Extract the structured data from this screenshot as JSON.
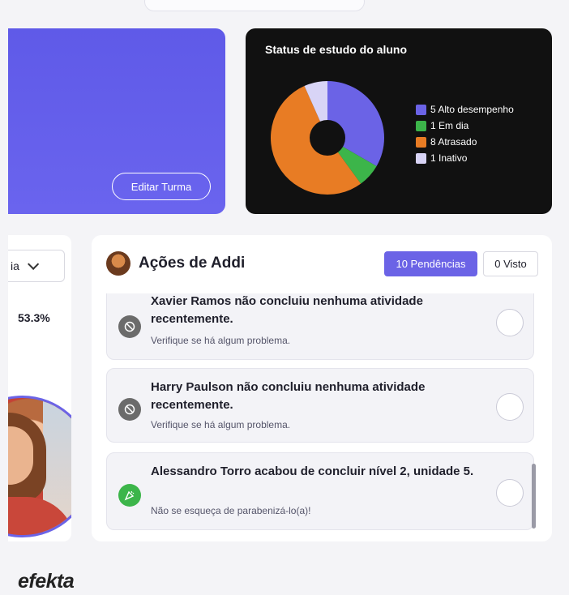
{
  "class_card": {
    "edit_button_label": "Editar Turma"
  },
  "status_card": {
    "title": "Status de estudo do aluno",
    "legend": [
      {
        "label": "5 Alto desempenho",
        "color": "#6b63e6"
      },
      {
        "label": "1 Em dia",
        "color": "#3cb54a"
      },
      {
        "label": "8 Atrasado",
        "color": "#e87c24"
      },
      {
        "label": "1 Inativo",
        "color": "#d8d4f6"
      }
    ]
  },
  "chart_data": {
    "type": "pie",
    "title": "Status de estudo do aluno",
    "categories": [
      "Alto desempenho",
      "Em dia",
      "Atrasado",
      "Inativo"
    ],
    "values": [
      5,
      1,
      8,
      1
    ],
    "colors": [
      "#6b63e6",
      "#3cb54a",
      "#e87c24",
      "#d8d4f6"
    ],
    "donut": true,
    "legend_position": "right"
  },
  "left_panel": {
    "select_value": "ia",
    "percent_text": "53.3%"
  },
  "actions": {
    "title": "Ações de Addi",
    "pending_label": "10 Pendências",
    "seen_label": "0 Visto",
    "items": [
      {
        "title": "Xavier Ramos não concluiu nenhuma atividade recentemente.",
        "subtitle": "Verifique se há algum problema.",
        "icon": "clock-icon",
        "icon_color": "#6b6b6b"
      },
      {
        "title": "Harry Paulson não concluiu nenhuma atividade recentemente.",
        "subtitle": "Verifique se há algum problema.",
        "icon": "clock-icon",
        "icon_color": "#6b6b6b"
      },
      {
        "title": "Alessandro Torro acabou de concluir nível 2, unidade 5.",
        "subtitle": "Não se esqueça de parabenizá-lo(a)!",
        "icon": "party-icon",
        "icon_color": "#3cb54a"
      }
    ]
  },
  "brand": {
    "name": "efekta"
  }
}
